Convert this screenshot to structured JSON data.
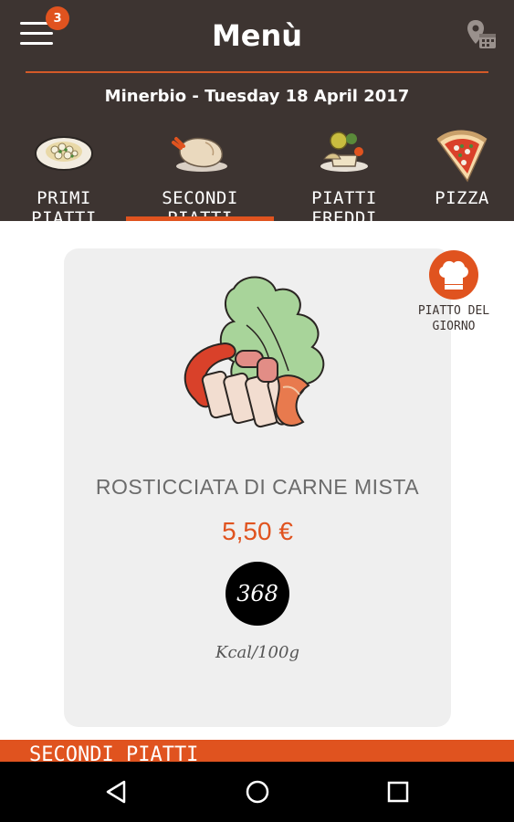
{
  "header": {
    "menu_badge": "3",
    "title": "Menù",
    "date_line": "Minerbio - Tuesday 18 April 2017"
  },
  "tabs": [
    {
      "label": "PRIMI PIATTI",
      "icon": "pasta-plate-icon",
      "active": false
    },
    {
      "label": "SECONDI PIATTI",
      "icon": "roast-chicken-icon",
      "active": true
    },
    {
      "label": "PIATTI FREDDI",
      "icon": "cold-plate-icon",
      "active": false
    },
    {
      "label": "PIZZA",
      "icon": "pizza-slice-icon",
      "active": false
    }
  ],
  "special": {
    "label_line1": "PIATTO DEL",
    "label_line2": "GIORNO",
    "icon": "chef-hat-icon"
  },
  "dish": {
    "name": "ROSTICCIATA DI CARNE MISTA",
    "price": "5,50 €",
    "kcal": "368",
    "kcal_unit": "Kcal/100g",
    "image_icon": "mixed-grill-icon"
  },
  "section": {
    "label": "SECONDI PIATTI"
  },
  "colors": {
    "accent": "#e0531f",
    "header_bg": "#3d3431",
    "card_bg": "#efefef"
  },
  "navbar": {
    "back_icon": "back-icon",
    "home_icon": "home-icon",
    "recents_icon": "recents-icon"
  }
}
